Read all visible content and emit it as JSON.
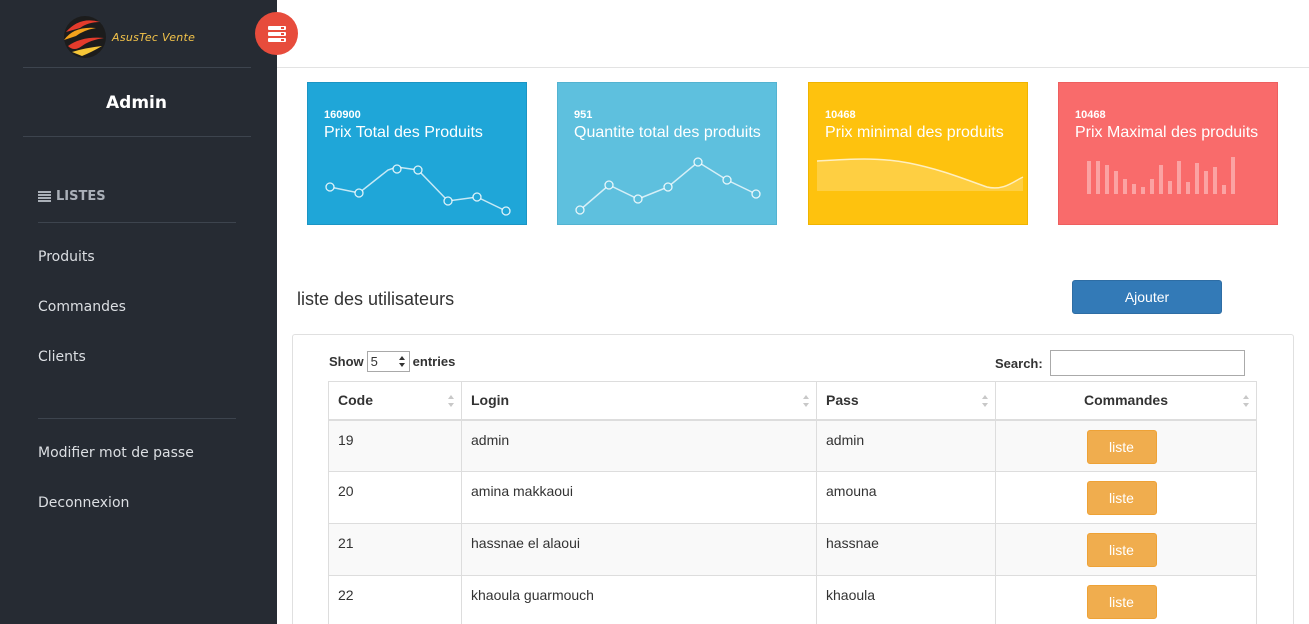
{
  "brand": {
    "name": "AsusTec Vente"
  },
  "sidebar": {
    "title": "Admin",
    "section_label": "LISTES",
    "items": [
      {
        "label": "Produits"
      },
      {
        "label": "Commandes"
      },
      {
        "label": "Clients"
      }
    ],
    "footer_items": [
      {
        "label": "Modifier mot de passe"
      },
      {
        "label": "Deconnexion"
      }
    ]
  },
  "cards": [
    {
      "value": "160900",
      "label": "Prix Total des Produits",
      "color": "#1fa6d8"
    },
    {
      "value": "951",
      "label": "Quantite total des produits",
      "color": "#5ec0de"
    },
    {
      "value": "10468",
      "label": "Prix minimal des produits",
      "color": "#fec20e"
    },
    {
      "value": "10468",
      "label": "Prix Maximal des produits",
      "color": "#f96b6b"
    }
  ],
  "list": {
    "title": "liste des utilisateurs",
    "add_label": "Ajouter",
    "show_label": "Show",
    "entries_label": "entries",
    "page_size": "5",
    "search_label": "Search:",
    "search_value": "",
    "columns": [
      "Code",
      "Login",
      "Pass",
      "Commandes"
    ],
    "rows": [
      {
        "code": "19",
        "login": "admin",
        "pass": "admin",
        "action": "liste"
      },
      {
        "code": "20",
        "login": "amina makkaoui",
        "pass": "amouna",
        "action": "liste"
      },
      {
        "code": "21",
        "login": "hassnae el alaoui",
        "pass": "hassnae",
        "action": "liste"
      },
      {
        "code": "22",
        "login": "khaoula guarmouch",
        "pass": "khaoula",
        "action": "liste"
      }
    ]
  },
  "colors": {
    "sidebar_bg": "#262b33",
    "toggle": "#e74c3c",
    "primary": "#337ab7",
    "warning": "#f0ad4e"
  }
}
